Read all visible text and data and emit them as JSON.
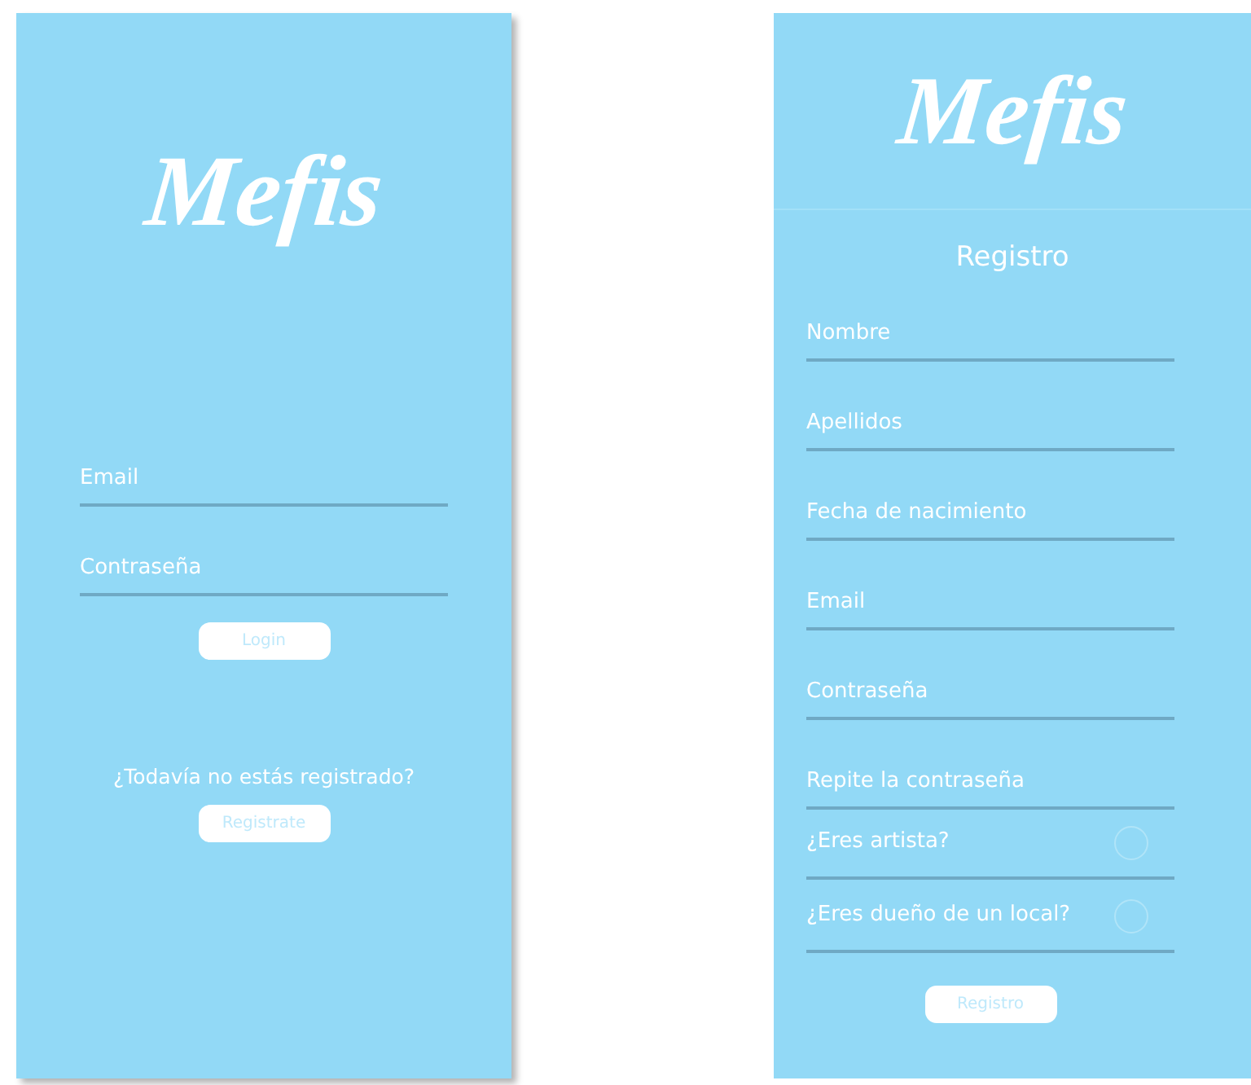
{
  "login_screen": {
    "logo": "Mefis",
    "fields": [
      {
        "placeholder": "Email"
      },
      {
        "placeholder": "Contraseña"
      }
    ],
    "login_button": "Login",
    "register_prompt": "¿Todavía no estás registrado?",
    "register_button": "Registrate"
  },
  "register_screen": {
    "logo": "Mefis",
    "title": "Registro",
    "fields": [
      {
        "kind": "text",
        "placeholder": "Nombre"
      },
      {
        "kind": "text",
        "placeholder": "Apellidos"
      },
      {
        "kind": "text",
        "placeholder": "Fecha de nacimiento"
      },
      {
        "kind": "text",
        "placeholder": "Email"
      },
      {
        "kind": "text",
        "placeholder": "Contraseña"
      },
      {
        "kind": "text",
        "placeholder": "Repite la contraseña"
      },
      {
        "kind": "check",
        "label": "¿Eres artista?",
        "checked": false
      },
      {
        "kind": "check",
        "label": "¿Eres dueño de un local?",
        "checked": false
      }
    ],
    "submit_button": "Registro"
  }
}
